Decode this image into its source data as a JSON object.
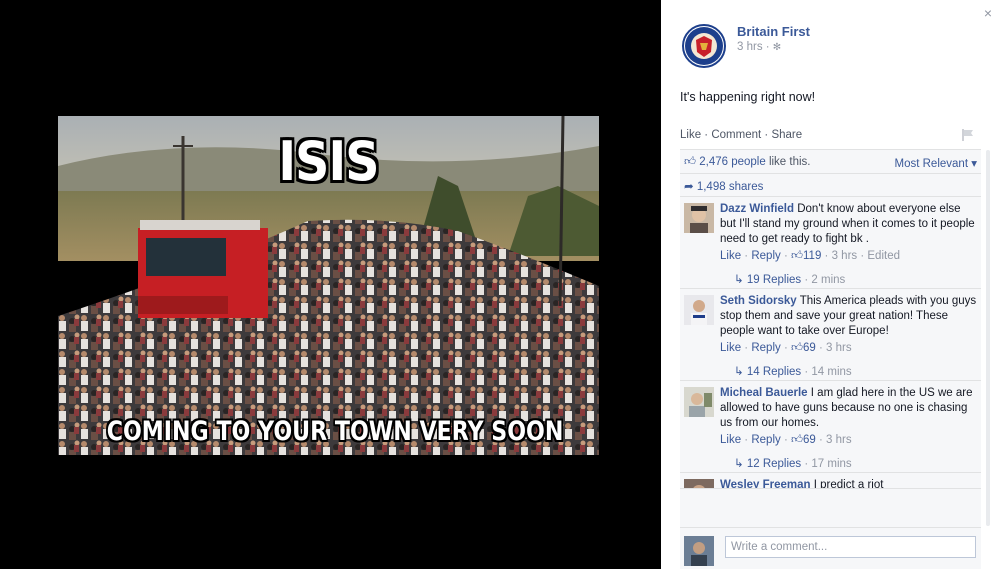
{
  "meme": {
    "top_text": "ISIS",
    "bottom_text": "COMING TO YOUR TOWN VERY SOON"
  },
  "post": {
    "page_name": "Britain First",
    "time": "3 hrs ·",
    "text": "It's happening right now!",
    "close_label": "×"
  },
  "actions": {
    "like": "Like",
    "comment": "Comment",
    "share": "Share"
  },
  "feedback": {
    "likes_count": "2,476 people",
    "likes_suffix": " like this.",
    "sort_label": "Most Relevant ▾",
    "shares": "1,498 shares"
  },
  "comments": [
    {
      "name": "Dazz Winfield",
      "text": "Don't know about everyone else but I'll stand my ground when it comes to it people need to get ready to fight bk .",
      "like": "Like",
      "reply": "Reply",
      "likes": "119",
      "time": "3 hrs · Edited",
      "replies": "19 Replies",
      "replies_time": "· 2 mins"
    },
    {
      "name": "Seth Sidorsky",
      "text": "This America pleads with you guys stop them and save your great nation! These people want to take over Europe!",
      "like": "Like",
      "reply": "Reply",
      "likes": "69",
      "time": "3 hrs",
      "replies": "14 Replies",
      "replies_time": "· 14 mins"
    },
    {
      "name": "Micheal Bauerle",
      "text": "I am glad here in the US we are allowed to have guns because no one is chasing us from our homes.",
      "like": "Like",
      "reply": "Reply",
      "likes": "69",
      "time": "3 hrs",
      "replies": "12 Replies",
      "replies_time": "· 17 mins"
    },
    {
      "name": "Wesley Freeman",
      "text": "I predict a riot"
    }
  ],
  "composer": {
    "placeholder": "Write a comment..."
  },
  "colors": {
    "link": "#3b5998",
    "meta": "#9197a3",
    "feedback_bg": "#f6f7f9"
  }
}
